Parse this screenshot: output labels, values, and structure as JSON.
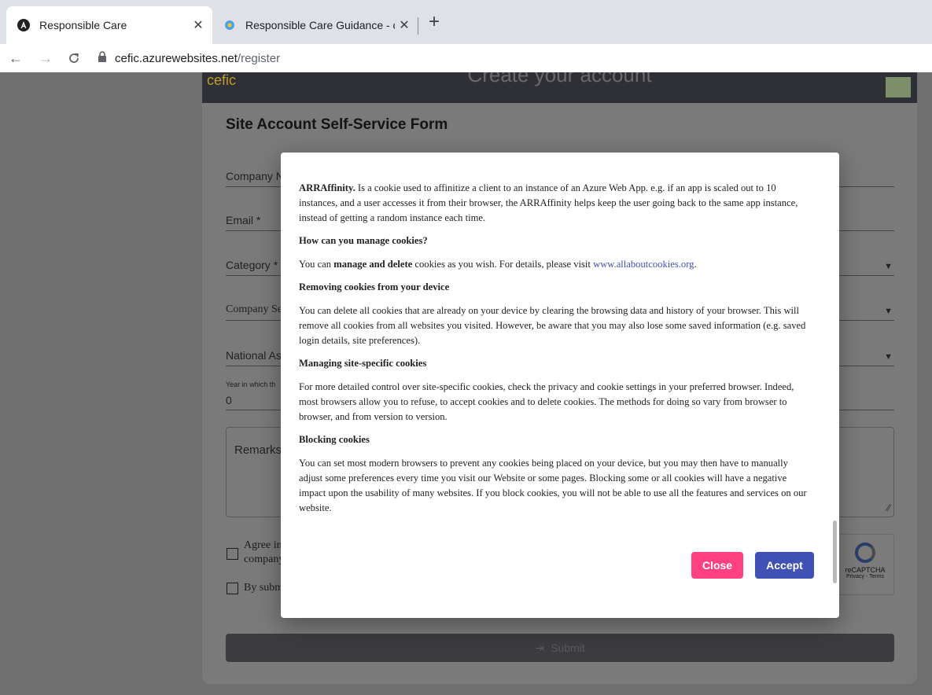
{
  "browser": {
    "tabs": [
      {
        "title": "Responsible Care",
        "favicon": "angular-icon",
        "active": true
      },
      {
        "title": "Responsible Care Guidance - cefi",
        "favicon": "gear-flower-icon",
        "active": false
      }
    ],
    "new_tab": "+",
    "url_host": "cefic.azurewebsites.net",
    "url_path": "/register"
  },
  "page": {
    "header_title": "Create your account",
    "logo_text": "cefic",
    "form_title": "Site Account Self-Service Form",
    "fields": {
      "company_name": "Company N",
      "email": "Email *",
      "category": "Category *",
      "company_sector": "Company Se",
      "national_association": "National As",
      "year_label": "Year in which th",
      "year_value": "0",
      "remarks": "Remarks"
    },
    "agree_text_1": "Agree in",
    "agree_text_2": "company",
    "by_submit_text": "By subm",
    "recaptcha_label": "reCAPTCHA",
    "recaptcha_links": "Privacy - Terms",
    "submit_label": "Submit"
  },
  "modal": {
    "arraffinity_term": "ARRAffinity.",
    "arraffinity_text": "Is a cookie used to affinitize a client to an instance of an Azure Web App. e.g. if an app is scaled out to 10 instances, and a user accesses it from their browser, the ARRAffinity helps keep the user going back to the same app instance, instead of getting a random instance each time.",
    "manage_heading": "How can you manage cookies?",
    "manage_text_1": "You can",
    "manage_text_bold": "manage and delete",
    "manage_text_2": "cookies as you wish. For details, please visit",
    "manage_link": "www.allaboutcookies.org",
    "removing_heading": "Removing cookies from your device",
    "removing_text": "You can delete all cookies that are already on your device by clearing the browsing data and history of your browser. This will remove all cookies from all websites you visited. However, be aware that you may also lose some saved information (e.g. saved login details, site preferences).",
    "site_heading": "Managing site-specific cookies",
    "site_text": "For more detailed control over site-specific cookies, check the privacy and cookie settings in your preferred browser. Indeed, most browsers allow you to refuse, to accept cookies and to delete cookies. The methods for doing so vary from browser to browser, and from version to version.",
    "blocking_heading": "Blocking cookies",
    "blocking_text": "You can set most modern browsers to prevent any cookies being placed on your device, but you may then have to manually adjust some preferences every time you visit our Website or some pages. Blocking some or all cookies will have a negative impact upon the usability of many websites. If you block cookies, you will not be able to use all the features and services on our website.",
    "close_label": "Close",
    "accept_label": "Accept"
  },
  "colors": {
    "close": "#ff4081",
    "accept": "#3f51b5",
    "link": "#3f51b5"
  }
}
